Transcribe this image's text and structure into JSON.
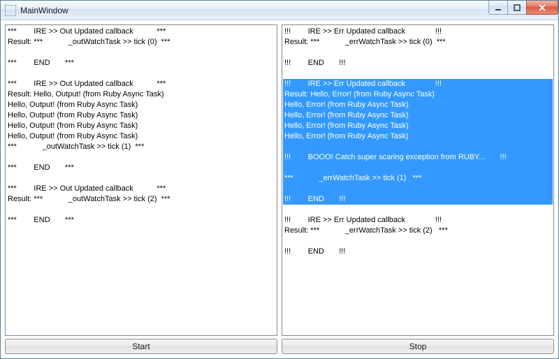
{
  "window": {
    "title": "MainWindow"
  },
  "left_pane": {
    "lines": [
      {
        "text": "***        IRE >> Out Updated callback           ***",
        "selected": false
      },
      {
        "text": "Result: ***            _outWatchTask >> tick (0)  ***",
        "selected": false
      },
      {
        "text": "",
        "selected": false
      },
      {
        "text": "***        END       ***",
        "selected": false
      },
      {
        "text": "",
        "selected": false
      },
      {
        "text": "***        IRE >> Out Updated callback           ***",
        "selected": false
      },
      {
        "text": "Result: Hello, Output! (from Ruby Async Task)",
        "selected": false
      },
      {
        "text": "Hello, Output! (from Ruby Async Task)",
        "selected": false
      },
      {
        "text": "Hello, Output! (from Ruby Async Task)",
        "selected": false
      },
      {
        "text": "Hello, Output! (from Ruby Async Task)",
        "selected": false
      },
      {
        "text": "Hello, Output! (from Ruby Async Task)",
        "selected": false
      },
      {
        "text": "***            _outWatchTask >> tick (1)  ***",
        "selected": false
      },
      {
        "text": "",
        "selected": false
      },
      {
        "text": "***        END       ***",
        "selected": false
      },
      {
        "text": "",
        "selected": false
      },
      {
        "text": "***        IRE >> Out Updated callback           ***",
        "selected": false
      },
      {
        "text": "Result: ***            _outWatchTask >> tick (2)  ***",
        "selected": false
      },
      {
        "text": "",
        "selected": false
      },
      {
        "text": "***        END       ***",
        "selected": false
      }
    ]
  },
  "right_pane": {
    "lines": [
      {
        "text": "!!!        IRE >> Err Updated callback              !!!",
        "selected": false
      },
      {
        "text": "Result: ***            _errWatchTask >> tick (0)  ***",
        "selected": false
      },
      {
        "text": "",
        "selected": false
      },
      {
        "text": "!!!        END       !!!",
        "selected": false
      },
      {
        "text": "",
        "selected": false
      },
      {
        "text": "!!!        IRE >> Err Updated callback              !!!",
        "selected": true
      },
      {
        "text": "Result: Hello, Error! (from Ruby Async Task)",
        "selected": true
      },
      {
        "text": "Hello, Error! (from Ruby Async Task)",
        "selected": true
      },
      {
        "text": "Hello, Error! (from Ruby Async Task)",
        "selected": true
      },
      {
        "text": "Hello, Error! (from Ruby Async Task)",
        "selected": true
      },
      {
        "text": "Hello, Error! (from Ruby Async Task)",
        "selected": true
      },
      {
        "text": "",
        "selected": true
      },
      {
        "text": "!!!        BOOO! Catch super scaring exception from RUBY...       !!!",
        "selected": true
      },
      {
        "text": "",
        "selected": true
      },
      {
        "text": "***            _errWatchTask >> tick (1)   ***",
        "selected": true
      },
      {
        "text": "",
        "selected": true
      },
      {
        "text": "!!!        END       !!!",
        "selected": true
      },
      {
        "text": "",
        "selected": false
      },
      {
        "text": "!!!        IRE >> Err Updated callback              !!!",
        "selected": false
      },
      {
        "text": "Result: ***            _errWatchTask >> tick (2)   ***",
        "selected": false
      },
      {
        "text": "",
        "selected": false
      },
      {
        "text": "!!!        END       !!!",
        "selected": false
      }
    ]
  },
  "buttons": {
    "start": "Start",
    "stop": "Stop"
  }
}
